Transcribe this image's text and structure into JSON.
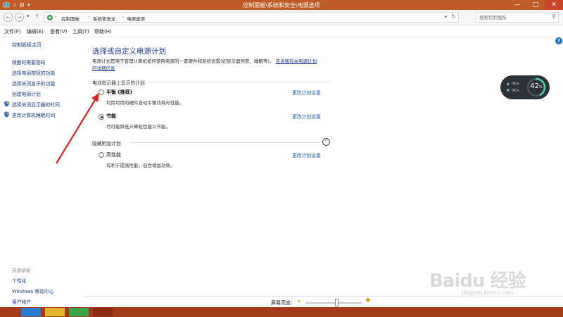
{
  "window": {
    "title": "控制面板\\系统和安全\\电源选项",
    "min_glyph": "—",
    "max_glyph": "□",
    "close_glyph": "✕"
  },
  "address": {
    "crumbs": [
      "控制面板",
      "系统和安全",
      "电源选项"
    ],
    "separator": "›",
    "search_placeholder": "搜索控制面板"
  },
  "menu": {
    "items": [
      "文件(F)",
      "编辑(E)",
      "查看(V)",
      "工具(T)",
      "帮助(H)"
    ]
  },
  "sidebar": {
    "home": "控制面板主页",
    "items": [
      {
        "label": "唤醒时需要密码"
      },
      {
        "label": "选择电源按钮的功能"
      },
      {
        "label": "选择关闭盖子的功能"
      },
      {
        "label": "创建电源计划"
      },
      {
        "label": "选择关闭显示器的时间"
      },
      {
        "label": "更改计算机睡眠时间"
      }
    ],
    "see_also_title": "另请参阅",
    "see_also": [
      {
        "label": "个性化"
      },
      {
        "label": "Windows 移动中心"
      },
      {
        "label": "用户帐户"
      }
    ]
  },
  "main": {
    "heading": "选择或自定义电源计划",
    "description": "电源计划是用于管理计算机如何使用电源的一套硬件和系统设置(如显示器亮度、睡眠等)。",
    "description_link": "告诉我有关电源计划",
    "description_link2": "的详细信息",
    "battery_section": "电池指示器上显示的计划",
    "plans": [
      {
        "name": "平衡 (推荐)",
        "desc": "利用可用的硬件自动平衡功耗与性能。",
        "link": "更改计划设置",
        "checked": false
      },
      {
        "name": "节能",
        "desc": "尽可能降低计算机性能以节能。",
        "link": "更改计划设置",
        "checked": true
      }
    ],
    "hidden_section": "隐藏附加计划",
    "hidden_plans": [
      {
        "name": "高性能",
        "desc": "有利于提高性能，但会增加功耗。",
        "link": "更改计划设置",
        "checked": false
      }
    ]
  },
  "widget": {
    "percent": "42",
    "percent_unit": "%",
    "up_rate": "0K/s",
    "down_rate": "0K/s",
    "level": 0.42
  },
  "bottom": {
    "brightness_label": "屏幕亮度:",
    "brightness_level": 0.55
  },
  "watermark": {
    "text": "Baidu 经验",
    "sub": "jingyan.baidu.com"
  },
  "colors": {
    "titlebar": "#c05a26",
    "taskbar": "#a33d19",
    "heading": "#1f3a93",
    "link": "#1a5fb4",
    "annotation_arrow": "#e02020"
  }
}
